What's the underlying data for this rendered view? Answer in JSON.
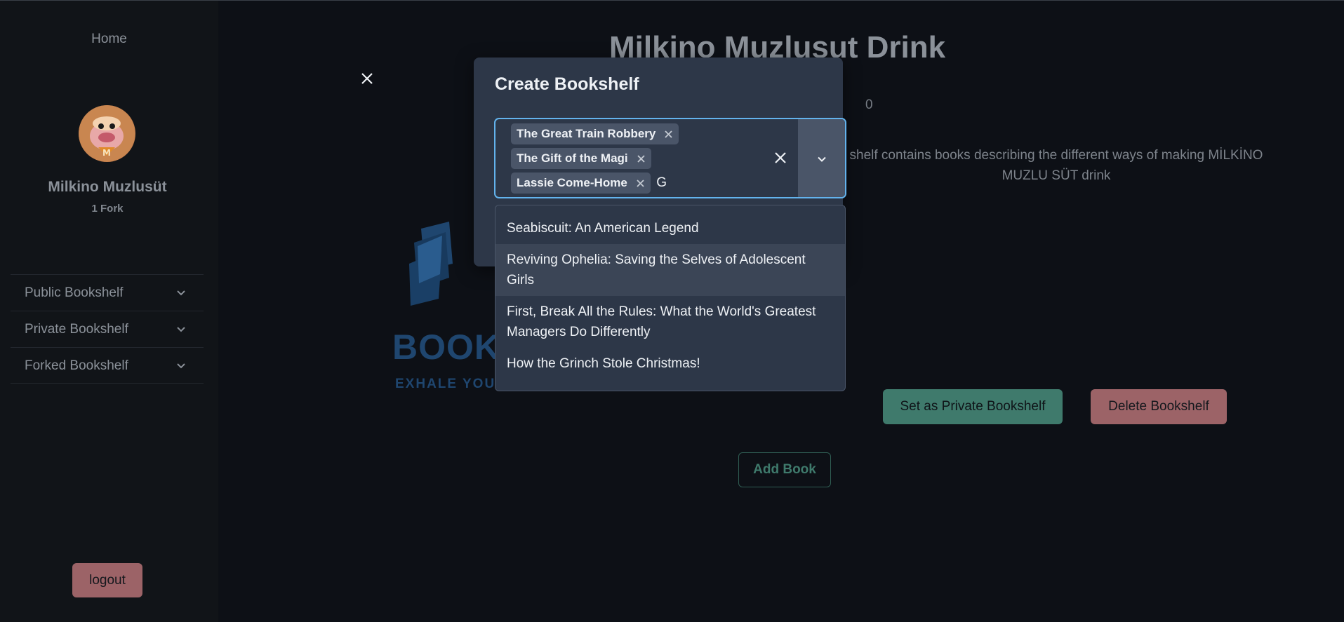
{
  "sidebar": {
    "home": "Home",
    "user_name": "Milkino Muzlusüt",
    "forks": "1 Fork",
    "nav": [
      {
        "label": "Public Bookshelf"
      },
      {
        "label": "Private Bookshelf"
      },
      {
        "label": "Forked Bookshelf"
      }
    ],
    "logout": "logout"
  },
  "page": {
    "title": "Milkino Muzlusut Drink",
    "stat": "0",
    "description": "shelf contains books describing the different ways of making MİLKİNO MUZLU SÜT drink",
    "logo_text": "BOOK",
    "logo_sub": "EXHALE YOU",
    "set_private": "Set as Private Bookshelf",
    "delete": "Delete Bookshelf",
    "add_book": "Add Book"
  },
  "modal": {
    "title": "Create Bookshelf",
    "selected_books": [
      "The Great Train Robbery",
      "The Gift of the Magi",
      "Lassie Come-Home"
    ],
    "search_value": "G",
    "options": [
      "Seabiscuit: An American Legend",
      "Reviving Ophelia: Saving the Selves of Adolescent Girls",
      "First, Break All the Rules: What the World's Greatest Managers Do Differently",
      "How the Grinch Stole Christmas!"
    ],
    "highlighted_option": 1
  },
  "colors": {
    "accent_focus": "#63b3ed",
    "primary_green": "#3f7a6c",
    "danger_red": "#9c6367",
    "modal_bg": "#2d3748"
  }
}
